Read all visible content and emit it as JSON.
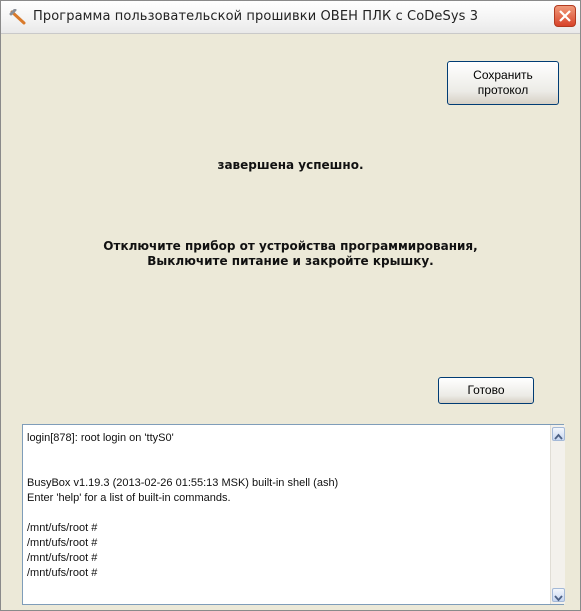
{
  "window": {
    "title": "Программа пользовательской прошивки ОВЕН ПЛК с CoDeSys 3"
  },
  "buttons": {
    "save_label": "Сохранить протокол",
    "done_label": "Готово"
  },
  "messages": {
    "status": "завершена успешно.",
    "instruction_line1": "Отключите прибор от устройства программирования,",
    "instruction_line2": "Выключите питание и закройте крышку."
  },
  "log": {
    "lines": [
      "login[878]: root login on 'ttyS0'",
      "",
      "",
      "BusyBox v1.19.3 (2013-02-26 01:55:13 MSK) built-in shell (ash)",
      "Enter 'help' for a list of built-in commands.",
      "",
      "/mnt/ufs/root #",
      "/mnt/ufs/root #",
      "/mnt/ufs/root #",
      "/mnt/ufs/root #"
    ]
  },
  "icons": {
    "app": "wrench-icon",
    "close": "close-icon",
    "scroll_up": "scroll-up-icon",
    "scroll_down": "scroll-down-icon"
  },
  "colors": {
    "close_button": "#d8432a",
    "button_border": "#003c74",
    "dialog_background": "#ece9d8"
  }
}
